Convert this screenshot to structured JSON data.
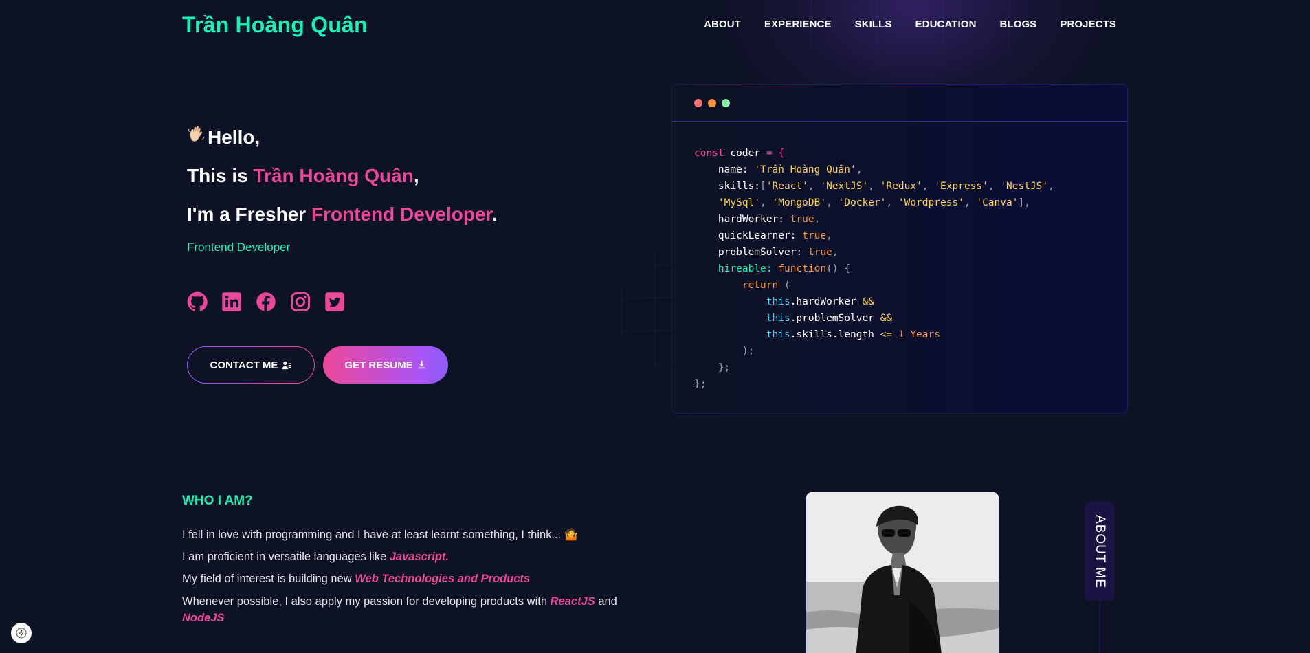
{
  "brand": "Trần Hoàng Quân",
  "nav": [
    "ABOUT",
    "EXPERIENCE",
    "SKILLS",
    "EDUCATION",
    "BLOGS",
    "PROJECTS"
  ],
  "hero": {
    "greeting": "Hello,",
    "line2_prefix": "This is ",
    "line2_name": "Trần Hoàng Quân",
    "line2_suffix": ",",
    "line3_prefix": "I'm a Fresher ",
    "line3_role": "Frontend Developer",
    "line3_suffix": ".",
    "subtitle": "Frontend Developer"
  },
  "socials": [
    "github-icon",
    "linkedin-icon",
    "facebook-icon",
    "instagram-icon",
    "twitter-icon"
  ],
  "buttons": {
    "contact": "CONTACT ME",
    "resume": "GET RESUME"
  },
  "code": {
    "dots": [
      "#f87171",
      "#fb923c",
      "#86efac"
    ],
    "line1": {
      "kw": "const",
      "name": " coder ",
      "op": "= {"
    },
    "name_key": "name: ",
    "name_val": "'Trần Hoàng Quân'",
    "skills_key": "skills:",
    "skills_row1": [
      "'React'",
      "'NextJS'",
      "'Redux'",
      "'Express'",
      "'NestJS'"
    ],
    "skills_row2": [
      "'MySql'",
      "'MongoDB'",
      "'Docker'",
      "'Wordpress'",
      "'Canva'"
    ],
    "hardWorker": "hardWorker: ",
    "quickLearner": "quickLearner: ",
    "problemSolver": "problemSolver: ",
    "bool": "true",
    "hireable": "hireable: ",
    "function_kw": "function",
    "function_rest": "() {",
    "return_kw": "return",
    "return_open": " (",
    "this_kw": "this",
    "cond1": ".hardWorker ",
    "cond2": ".problemSolver ",
    "cond3": ".skills.length ",
    "and_op": "&&",
    "lte_op": "<=",
    "years": " 1 Years",
    "close_paren": ");",
    "close_fn": "};",
    "close_obj": "};"
  },
  "about": {
    "heading": "WHO I AM?",
    "p1": "I fell in love with programming and I have at least learnt something, I think... 🤷",
    "p2_text": "I am proficient in versatile languages like ",
    "p2_em": "Javascript.",
    "p3_text": "My field of interest is building new ",
    "p3_em": "Web Technologies and Products",
    "p4_text": "Whenever possible, I also apply my passion for developing products with ",
    "p4_em1": "ReactJS",
    "p4_mid": " and ",
    "p4_em2": "NodeJS",
    "tab": "ABOUT ME"
  },
  "colors": {
    "accent_green": "#16f2b3",
    "accent_pink": "#ec4899",
    "accent_violet": "#8b5cf6",
    "background": "#0d1224"
  }
}
